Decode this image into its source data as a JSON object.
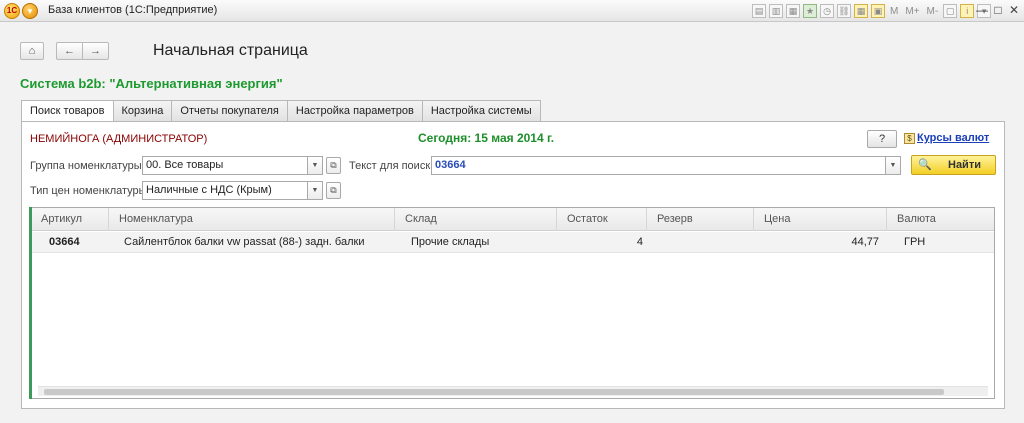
{
  "window": {
    "title": "База клиентов  (1С:Предприятие)",
    "toolbar_letters": [
      "M",
      "M+",
      "M-"
    ],
    "controls": [
      "minimize",
      "maximize",
      "close"
    ]
  },
  "nav": {
    "home_icon": "home-icon",
    "back_icon": "arrow-left-icon",
    "forward_icon": "arrow-right-icon",
    "page_title": "Начальная страница"
  },
  "system_title": "Система b2b: \"Альтернативная энергия\"",
  "tabs": [
    {
      "label": "Поиск товаров",
      "active": true
    },
    {
      "label": "Корзина",
      "active": false
    },
    {
      "label": "Отчеты покупателя",
      "active": false
    },
    {
      "label": "Настройка параметров",
      "active": false
    },
    {
      "label": "Настройка системы",
      "active": false
    }
  ],
  "header": {
    "user": "НЕМИЙНОГА   (АДМИНИСТРАТОР)",
    "today": "Сегодня: 15 мая 2014 г.",
    "help_label": "?",
    "rates_link": "Курсы валют"
  },
  "filters": {
    "group_label": "Группа номенклатуры   :",
    "group_value": "00. Все товары",
    "price_type_label": "Тип цен номенклатуры:",
    "price_type_value": "Наличные с НДС (Крым)",
    "search_label": "Текст для поиска:",
    "search_value": "03664",
    "find_label": "Найти"
  },
  "table": {
    "columns": [
      "Артикул",
      "Номенклатура",
      "Склад",
      "Остаток",
      "Резерв",
      "Цена",
      "Валюта"
    ],
    "rows": [
      {
        "article": "03664",
        "name": "Сайлентблок балки vw passat (88-) задн. балки",
        "warehouse": "Прочие склады",
        "stock": "4",
        "reserve": "",
        "price": "44,77",
        "currency": "ГРН"
      }
    ]
  },
  "colors": {
    "system_title": "#1d9a2f",
    "user": "#8b0000",
    "today": "#1d8f2a",
    "link": "#1a3fb8",
    "find_button": "#f2cf25"
  }
}
